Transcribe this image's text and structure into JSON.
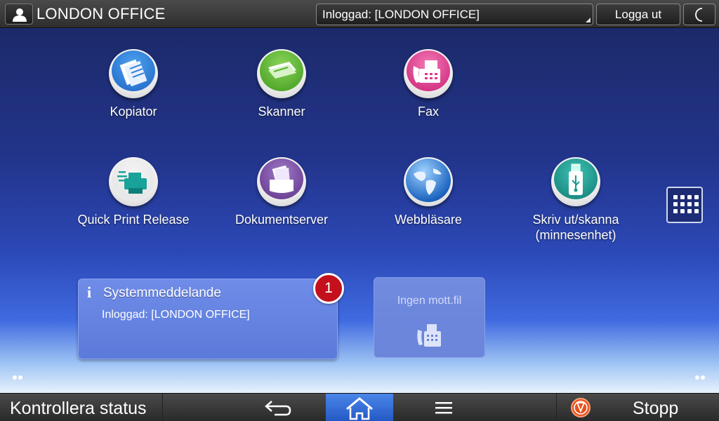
{
  "header": {
    "user_name": "LONDON OFFICE",
    "login_status": "Inloggad: [LONDON OFFICE]",
    "logout_label": "Logga ut"
  },
  "apps": [
    {
      "label": "Kopiator",
      "icon": "copier-icon",
      "color": "#2a7bd6"
    },
    {
      "label": "Skanner",
      "icon": "scanner-icon",
      "color": "#59b52d"
    },
    {
      "label": "Fax",
      "icon": "fax-icon",
      "color": "#e0378a"
    },
    {
      "label": "Quick Print Release",
      "icon": "quick-print-icon",
      "color": "#18a29a"
    },
    {
      "label": "Dokumentserver",
      "icon": "document-server-icon",
      "color": "#7a4ba6"
    },
    {
      "label": "Webbläsare",
      "icon": "globe-icon",
      "color": "#2d7fd1"
    },
    {
      "label": "Skriv ut/skanna",
      "label2": "(minnesenhet)",
      "icon": "usb-icon",
      "color": "#179a8f"
    }
  ],
  "system_message": {
    "title": "Systemmeddelande",
    "body": "Inloggad: [LONDON OFFICE]",
    "count": "1"
  },
  "fax_widget": {
    "title": "Ingen mott.fil"
  },
  "footer": {
    "check_status": "Kontrollera status",
    "stop": "Stopp"
  }
}
